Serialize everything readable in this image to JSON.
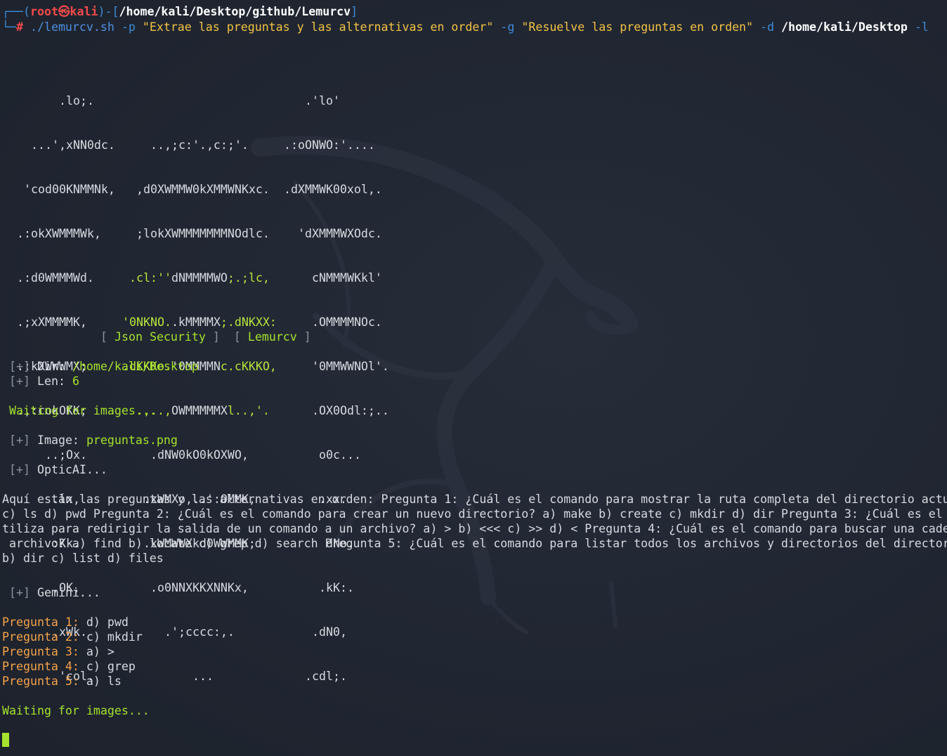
{
  "prompt": {
    "corner_top": "┌──(",
    "user": "root",
    "at": "㉿",
    "host": "kali",
    "mid": ")-[",
    "cwd": "/home/kali/Desktop/github/Lemurcv",
    "end": "]",
    "corner_bottom": "└─",
    "hash": "#"
  },
  "command": {
    "script": "./lemurcv.sh",
    "flag_p": "-p",
    "arg_p": "\"Extrae las preguntas y las alternativas en order\"",
    "flag_g": "-g",
    "arg_g": "\"Resuelve las preguntas en orden\"",
    "flag_d": "-d",
    "arg_d": "/home/kali/Desktop",
    "flag_l": "-l"
  },
  "ascii_art": {
    "left": [
      ".lo;.",
      "...',xNN0dc.",
      "'cod00KNMMNk,",
      ".:okXWMMMWk,",
      ".:d0WMMMWd.",
      ".;xXMMMMK,",
      ".:kXWWWMX;",
      ".,:cokOKK;",
      "..;Ox.",
      ".lx,",
      ":Kk.",
      ",OK,",
      ".xWk.",
      "'col."
    ],
    "center_white": [
      "..,;c:'.,c:;'.",
      ",d0XWMMW0kXMMWNKxc.",
      ";lokXWMMMMMMMNOdlc."
    ],
    "center_mixed": [
      [
        ".cl:''",
        "dNMMMMWO",
        ";.;lc,"
      ],
      [
        "'0NKNO.",
        ".kMMMMX",
        ";.dNKXX:"
      ],
      [
        ".dKKKo.",
        "'0MMMMN",
        "c.cKKKO,"
      ],
      [
        ".,..,",
        "OWMMMMMX",
        "l..,'."
      ]
    ],
    "center_bottom": [
      ".dNW0kO0kOXWO,",
      ".xWMXo,..':OMMK,",
      ".xWMWWXkd0WWMMK;",
      ".o0NNXKKXNNKx,",
      ".';cccc:,.",
      "..."
    ],
    "right": [
      ".'lo'",
      ".:oONWO:'....",
      ".dXMMWK00xol,.",
      "'dXMMMWXOdc.",
      "cNMMMWKkl'",
      ".OMMMMNOc.",
      "'0MMWWNOl'.",
      ".OX0Odl:;..",
      "o0c...",
      ".xx.",
      "dNo.",
      ".kK:.",
      ".dN0,",
      ".cdl;."
    ]
  },
  "banner": {
    "bracket_open": "[",
    "item1": "Json Security",
    "bracket_close": "]",
    "item2": "Lemurcv"
  },
  "status": {
    "marker": "[+]",
    "dir_label": "Dir:",
    "dir_value": "/home/kali/Desktop",
    "len_label": "Len:",
    "len_value": "6",
    "waiting": "Waiting for images...",
    "image_label": "Image:",
    "image_value": "preguntas.png",
    "optic": "OpticAI...",
    "gemini": "Gemini..."
  },
  "ocr_output": [
    "Aquí están las preguntas y las alternativas en orden: Pregunta 1: ¿Cuál es el comando para mostrar la ruta completa del directorio actu",
    "c) ls d) pwd Pregunta 2: ¿Cuál es el comando para crear un nuevo directorio? a) make b) create c) mkdir d) dir Pregunta 3: ¿Cuál es el",
    "tiliza para redirigir la salida de un comando a un archivo? a) > b) <<< c) >> d) < Pregunta 4: ¿Cuál es el comando para buscar una cade",
    " archivo? a) find b) locate c) grep d) search Pregunta 5: ¿Cuál es el comando para listar todos los archivos y directorios del director",
    "b) dir c) list d) files"
  ],
  "answers": [
    {
      "label": "Pregunta 1:",
      "answer": "d) pwd"
    },
    {
      "label": "Pregunta 2:",
      "answer": "c) mkdir"
    },
    {
      "label": "Pregunta 3:",
      "answer": "a) >"
    },
    {
      "label": "Pregunta 4:",
      "answer": "c) grep"
    },
    {
      "label": "Pregunta 5:",
      "answer": "a) ls"
    }
  ],
  "final_waiting": "Waiting for images...",
  "colors": {
    "background": "#1f2430",
    "prompt_blue": "#3d8bd9",
    "prompt_red": "#f24a4a",
    "green": "#a6e22e",
    "orange": "#f5a34a",
    "yellow_string": "#f2c343"
  },
  "icons": {
    "background_logo": "kali-dragon-icon",
    "cursor": "block-cursor-icon"
  }
}
